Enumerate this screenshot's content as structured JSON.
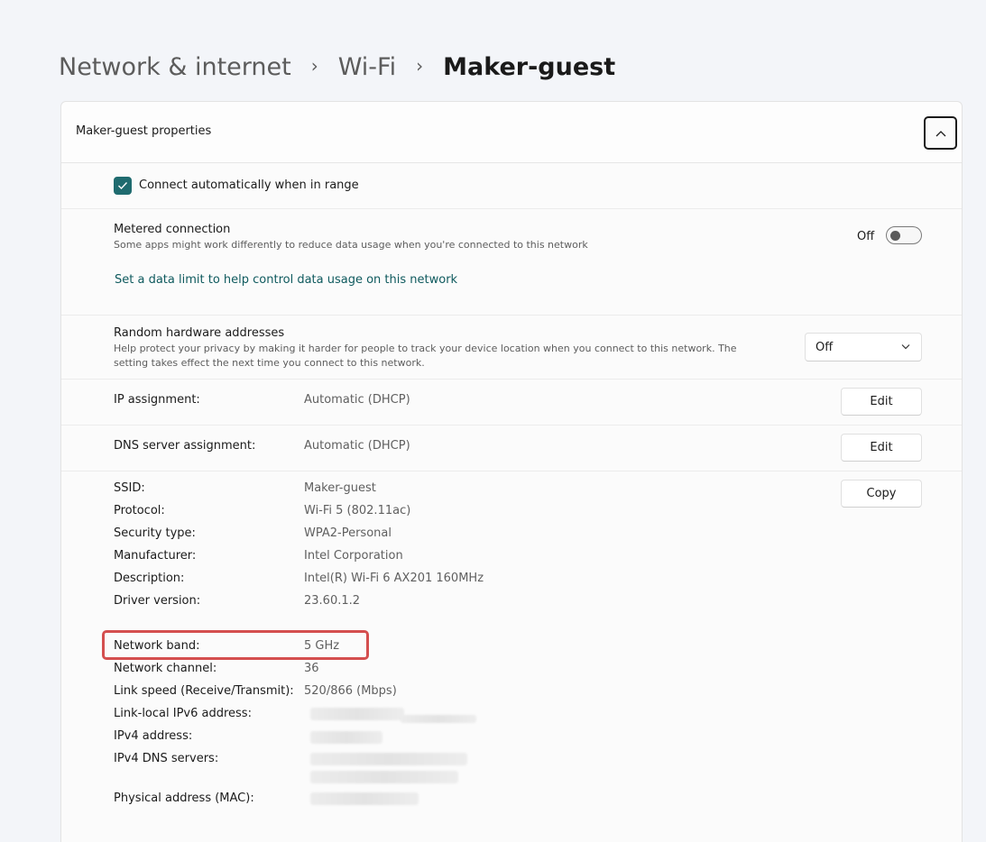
{
  "breadcrumb": {
    "items": [
      "Network & internet",
      "Wi-Fi"
    ],
    "current": "Maker-guest",
    "separator": "›"
  },
  "panel": {
    "title": "Maker-guest properties",
    "collapse_icon": "chevron-up-icon"
  },
  "auto_connect": {
    "label": "Connect automatically when in range",
    "checked": true
  },
  "metered": {
    "title": "Metered connection",
    "description": "Some apps might work differently to reduce data usage when you're connected to this network",
    "toggle_label": "Off",
    "toggle_on": false,
    "link": "Set a data limit to help control data usage on this network"
  },
  "random_hw": {
    "title": "Random hardware addresses",
    "description": "Help protect your privacy by making it harder for people to track your device location when you connect to this network. The setting takes effect the next time you connect to this network.",
    "selected": "Off"
  },
  "ip": {
    "label": "IP assignment:",
    "value": "Automatic (DHCP)",
    "button": "Edit"
  },
  "dns": {
    "label": "DNS server assignment:",
    "value": "Automatic (DHCP)",
    "button": "Edit"
  },
  "details": {
    "copy_button": "Copy",
    "rows": [
      {
        "label": "SSID:",
        "value": "Maker-guest"
      },
      {
        "label": "Protocol:",
        "value": "Wi-Fi 5 (802.11ac)"
      },
      {
        "label": "Security type:",
        "value": "WPA2-Personal"
      },
      {
        "label": "Manufacturer:",
        "value": "Intel Corporation"
      },
      {
        "label": "Description:",
        "value": "Intel(R) Wi-Fi 6 AX201 160MHz"
      },
      {
        "label": "Driver version:",
        "value": "23.60.1.2"
      }
    ],
    "rows2": [
      {
        "label": "Network band:",
        "value": "5 GHz"
      },
      {
        "label": "Network channel:",
        "value": "36"
      },
      {
        "label": "Link speed (Receive/Transmit):",
        "value": "520/866 (Mbps)"
      },
      {
        "label": "Link-local IPv6 address:",
        "value": ""
      },
      {
        "label": "IPv4 address:",
        "value": ""
      },
      {
        "label": "IPv4 DNS servers:",
        "value": ""
      },
      {
        "label": "Physical address (MAC):",
        "value": ""
      }
    ]
  },
  "colors": {
    "accent": "#1f6b6f",
    "highlight": "#d44f4f",
    "link": "#0f5a5e"
  }
}
